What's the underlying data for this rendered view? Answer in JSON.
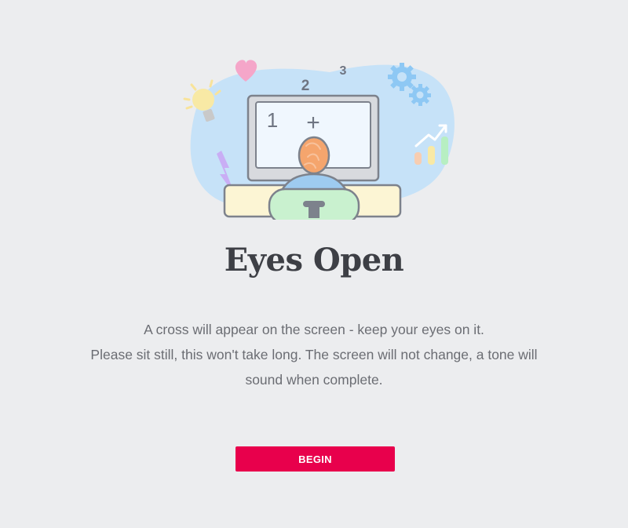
{
  "illustration": {
    "screen_number_1": "1",
    "screen_cross": "+",
    "floating_number_2": "2",
    "floating_number_3": "3"
  },
  "page": {
    "title": "Eyes Open",
    "instruction_line_1": "A cross will appear on the screen - keep your eyes on it.",
    "instruction_line_2": "Please sit still, this won't take long. The screen will not change, a tone will sound when complete."
  },
  "actions": {
    "begin_label": "BEGIN"
  },
  "colors": {
    "background": "#ecedef",
    "accent": "#e8004c",
    "title": "#3d3f45",
    "body_text": "#6b6d73"
  }
}
